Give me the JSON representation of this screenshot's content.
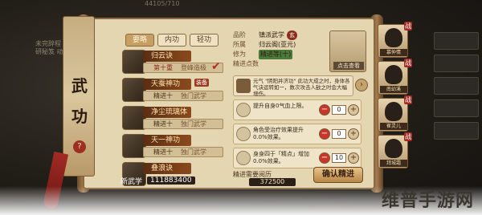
{
  "top_bar": {
    "items": [
      "44105/710"
    ]
  },
  "bg_left_text": "未完辞程 工研秘笈 动为",
  "banner": {
    "chars": [
      "武",
      "功"
    ],
    "help": "?"
  },
  "tabs": [
    {
      "label": "要略",
      "active": true
    },
    {
      "label": "内功",
      "active": false
    },
    {
      "label": "轻功",
      "active": false
    }
  ],
  "skills": [
    {
      "name": "归云诀",
      "sub": "第十重",
      "tag": "登峰造极",
      "checked": true
    },
    {
      "name": "天蚕神功",
      "sub": "精进十",
      "tag": "独门武学",
      "badge": "装备"
    },
    {
      "name": "净尘琉璃体",
      "sub": "精进十",
      "tag": "独门武学"
    },
    {
      "name": "天一神功",
      "sub": "精进十",
      "tag": "独门武学"
    },
    {
      "name": "叠浪诀",
      "sub": "",
      "tag": ""
    }
  ],
  "new_skill": {
    "label": "新武学",
    "count": "111883400"
  },
  "detail": {
    "attrs": [
      {
        "k": "品阶",
        "v": "镇派武学",
        "rank": "玄"
      },
      {
        "k": "所属",
        "v": "归云阁(亚元)"
      },
      {
        "k": "修为",
        "v": "精进等(十)",
        "state": true
      },
      {
        "k": "精进点数",
        "v": ""
      }
    ],
    "portrait_caption": "点击查看",
    "desc": "元气 \"阴阳并济功\" 此功大成之时，身体各气诀运转如一，数次攻击人敌之时会大幅增伤。",
    "props": [
      {
        "text": "提升自身0气血上限。",
        "value": "0"
      },
      {
        "text": "角色受治疗效果提升0.0%效果。",
        "value": "0"
      },
      {
        "text": "身身四于「精点」增加0.0%效果。",
        "value": "10"
      }
    ]
  },
  "bottom": {
    "exp_label": "精进需要阅历",
    "exp_value": "372500",
    "confirm": "确认精进"
  },
  "characters": [
    {
      "name": "慕仲情",
      "fight": "战"
    },
    {
      "name": "南幼溪",
      "fight": "战"
    },
    {
      "name": "崔灵儿",
      "fight": "战"
    },
    {
      "name": "拜城霜",
      "fight": "战"
    }
  ],
  "watermark": "维普手游网"
}
